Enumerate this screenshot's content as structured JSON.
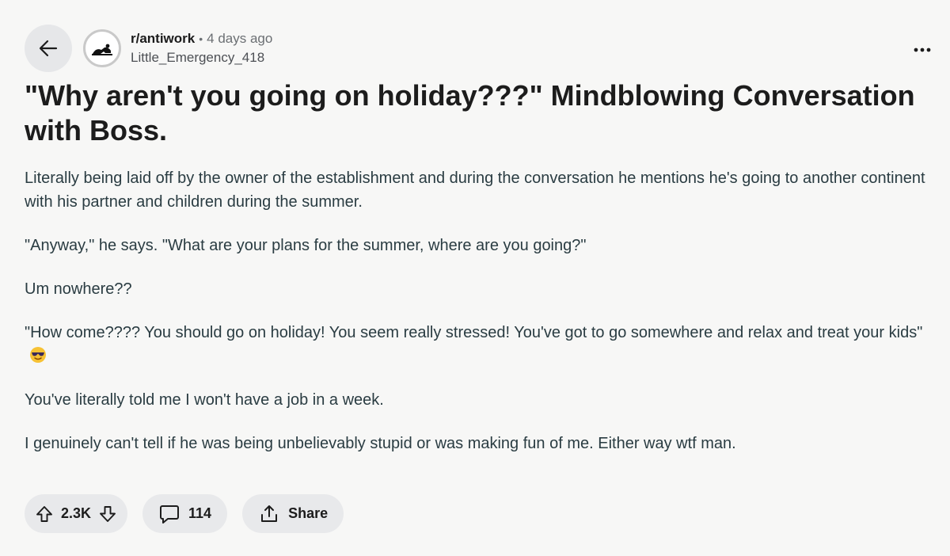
{
  "post": {
    "subreddit": "r/antiwork",
    "separator": "•",
    "time_ago": "4 days ago",
    "author": "Little_Emergency_418",
    "title": "\"Why aren't you going on holiday???\" Mindblowing Conversation with Boss.",
    "paragraphs": [
      "Literally being laid off by the owner of the establishment and during the conversation he mentions he's going to another continent with his partner and children during the summer.",
      "\"Anyway,\" he says. \"What are your plans for the summer, where are you going?\"",
      "Um nowhere??",
      "\"How come???? You should go on holiday! You seem really stressed! You've got to go somewhere and relax and treat your kids\"",
      "You've literally told me I won't have a job in a week.",
      "I genuinely can't tell if he was being unbelievably stupid or was making fun of me. Either way wtf man."
    ],
    "emoji": "sunglasses-emoji"
  },
  "actions": {
    "upvotes": "2.3K",
    "comments": "114",
    "share_label": "Share"
  },
  "icons": {
    "back": "back-arrow-icon",
    "more": "more-options-icon",
    "upvote": "upvote-arrow-icon",
    "downvote": "downvote-arrow-icon",
    "comment": "comment-icon",
    "share": "share-icon"
  },
  "colors": {
    "background": "#f7f7f6",
    "pill": "#e8e9eb",
    "back_button": "#e6e7e9",
    "text": "#1c1c1c",
    "body_text": "#2a3c42",
    "muted": "#6b6f73"
  }
}
